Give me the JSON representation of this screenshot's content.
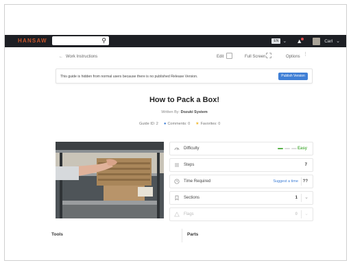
{
  "nav": {
    "brand": "HANSAW",
    "search_placeholder": "",
    "lang": "EN",
    "user": "Carl"
  },
  "toolbar": {
    "back_label": "Work Instructions",
    "edit_label": "Edit",
    "fullscreen_label": "Full Screen",
    "options_label": "Options"
  },
  "notice": {
    "text": "This guide is hidden from normal users because there is no published Release Version.",
    "button_label": "Publish Version"
  },
  "guide": {
    "title": "How to Pack a Box!",
    "written_by_label": "Written By:",
    "author": "Dozuki System",
    "guide_id": "Guide ID: 2",
    "comments": "Comments: 0",
    "favorites": "Favorites: 0"
  },
  "stats": {
    "difficulty_label": "Difficulty",
    "difficulty_value": "Easy",
    "difficulty_level": 1,
    "steps_label": "Steps",
    "steps_value": "7",
    "time_label": "Time Required",
    "time_link": "Suggest a time",
    "time_value": "??",
    "sections_label": "Sections",
    "sections_value": "1",
    "flags_label": "Flags",
    "flags_value": "0"
  },
  "sections": {
    "tools_label": "Tools",
    "parts_label": "Parts"
  },
  "colors": {
    "accent": "#3f7fd6",
    "brand": "#c4532a",
    "easy": "#59b34a",
    "nav_bg": "#1d1f24"
  }
}
